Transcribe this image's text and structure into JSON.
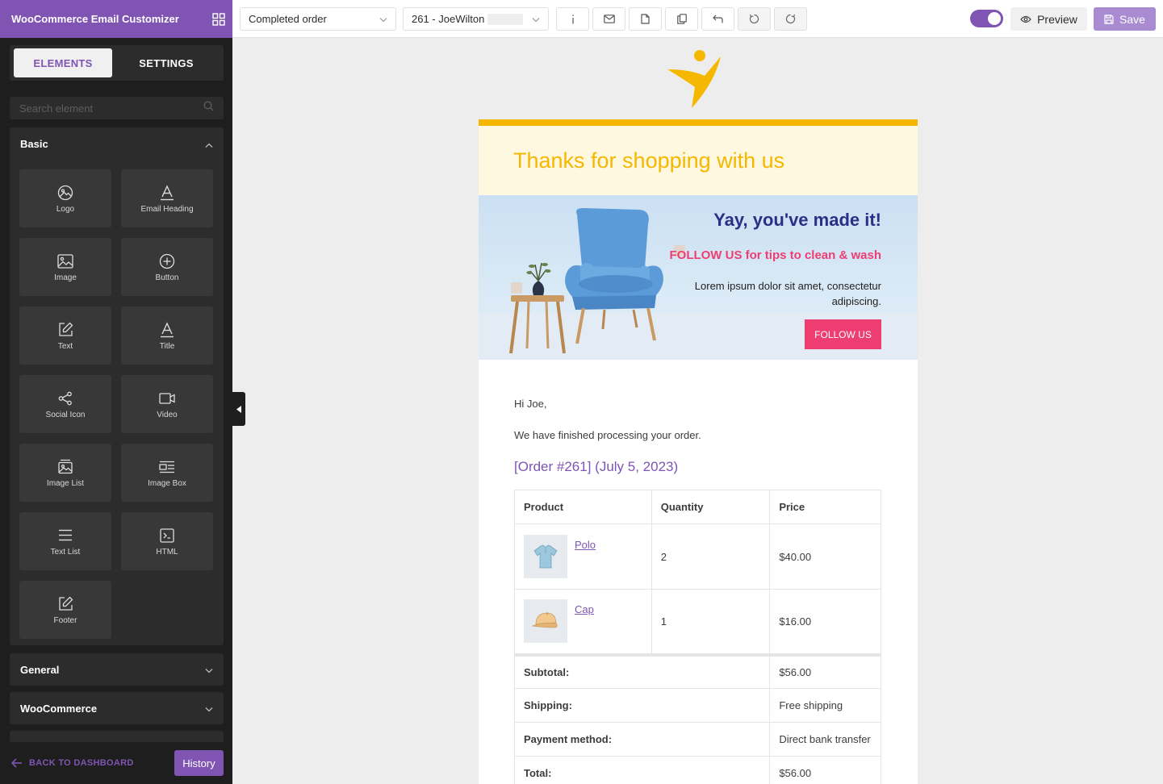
{
  "app": {
    "title": "WooCommerce Email Customizer"
  },
  "tabs": {
    "elements": "ELEMENTS",
    "settings": "SETTINGS"
  },
  "search": {
    "placeholder": "Search element"
  },
  "panels": {
    "basic": {
      "label": "Basic",
      "items": [
        {
          "label": "Logo",
          "icon": "logo-icon"
        },
        {
          "label": "Email Heading",
          "icon": "heading-icon"
        },
        {
          "label": "Image",
          "icon": "image-icon"
        },
        {
          "label": "Button",
          "icon": "plus-circle-icon"
        },
        {
          "label": "Text",
          "icon": "edit-icon"
        },
        {
          "label": "Title",
          "icon": "heading-icon"
        },
        {
          "label": "Social Icon",
          "icon": "share-icon"
        },
        {
          "label": "Video",
          "icon": "video-icon"
        },
        {
          "label": "Image List",
          "icon": "image-list-icon"
        },
        {
          "label": "Image Box",
          "icon": "image-box-icon"
        },
        {
          "label": "Text List",
          "icon": "list-icon"
        },
        {
          "label": "HTML",
          "icon": "code-icon"
        },
        {
          "label": "Footer",
          "icon": "edit-icon"
        }
      ]
    },
    "general": {
      "label": "General"
    },
    "woocommerce": {
      "label": "WooCommerce"
    }
  },
  "footer": {
    "back_label": "BACK TO DASHBOARD",
    "history_label": "History"
  },
  "topbar": {
    "template_value": "Completed order",
    "order_value": "261 - JoeWilton",
    "preview_label": "Preview",
    "save_label": "Save",
    "toggle_on": true
  },
  "email": {
    "heading": "Thanks for shopping with us",
    "banner": {
      "title": "Yay, you've made it!",
      "subtitle": "FOLLOW US for tips to clean & wash",
      "body": "Lorem ipsum dolor sit amet, consectetur adipiscing.",
      "button": "FOLLOW US"
    },
    "greeting": "Hi Joe,",
    "intro": "We have finished processing your order.",
    "order_heading": "[Order #261] (July 5, 2023)",
    "table": {
      "headers": [
        "Product",
        "Quantity",
        "Price"
      ],
      "items": [
        {
          "name": "Polo",
          "qty": "2",
          "price": "$40.00"
        },
        {
          "name": "Cap",
          "qty": "1",
          "price": "$16.00"
        }
      ],
      "totals": [
        {
          "label": "Subtotal:",
          "value": "$56.00"
        },
        {
          "label": "Shipping:",
          "value": "Free shipping"
        },
        {
          "label": "Payment method:",
          "value": "Direct bank transfer"
        },
        {
          "label": "Total:",
          "value": "$56.00"
        }
      ]
    }
  },
  "colors": {
    "brand": "#7f54b3",
    "accent_yellow": "#f5b700",
    "accent_pink": "#ee3d71",
    "banner_title": "#2c2f86"
  }
}
